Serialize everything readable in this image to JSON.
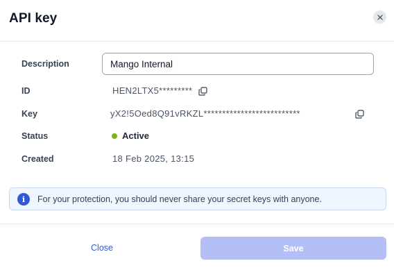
{
  "dialog": {
    "title": "API key",
    "close_icon": "close-icon"
  },
  "fields": {
    "description": {
      "label": "Description",
      "value": "Mango Internal"
    },
    "id": {
      "label": "ID",
      "value": "HEN2LTX5*********",
      "copy_icon": "copy-icon"
    },
    "key": {
      "label": "Key",
      "value": "yX2!5Oed8Q91vRKZL**************************",
      "copy_icon": "copy-icon"
    },
    "status": {
      "label": "Status",
      "value": "Active",
      "indicator_color": "#7cb518"
    },
    "created": {
      "label": "Created",
      "value": "18 Feb 2025, 13:15"
    }
  },
  "notice": {
    "icon": "info-icon",
    "text": "For your protection, you should never share your secret keys with anyone."
  },
  "footer": {
    "close_label": "Close",
    "save_label": "Save"
  },
  "colors": {
    "accent": "#3358d4",
    "save_disabled_bg": "#b4bff5",
    "notice_bg": "#f0f6ff",
    "status_active": "#7cb518"
  }
}
